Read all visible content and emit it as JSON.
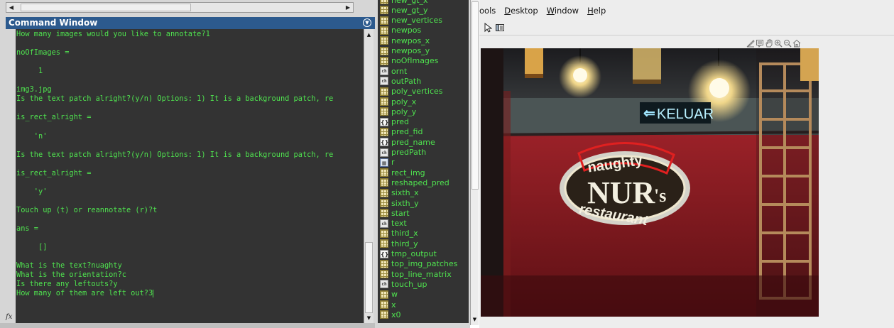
{
  "command_window": {
    "title": "Command Window",
    "lines": [
      "How many images would you like to annotate?1",
      "",
      "noOfImages =",
      "",
      "     1",
      "",
      "img3.jpg",
      "Is the text patch alright?(y/n) Options: 1) It is a background patch, re",
      "",
      "is_rect_alright =",
      "",
      "    'n'",
      "",
      "Is the text patch alright?(y/n) Options: 1) It is a background patch, re",
      "",
      "is_rect_alright =",
      "",
      "    'y'",
      "",
      "Touch up (t) or reannotate (r)?t",
      "",
      "ans =",
      "",
      "     []",
      "",
      "What is the text?nuaghty",
      "What is the orientation?c",
      "Is there any leftouts?y",
      "How many of them are left out?3"
    ],
    "prompt_symbol": "fx"
  },
  "workspace": {
    "items": [
      {
        "name": "new_gt_x",
        "type": "grid"
      },
      {
        "name": "new_gt_y",
        "type": "grid"
      },
      {
        "name": "new_vertices",
        "type": "grid"
      },
      {
        "name": "newpos",
        "type": "grid"
      },
      {
        "name": "newpos_x",
        "type": "grid"
      },
      {
        "name": "newpos_y",
        "type": "grid"
      },
      {
        "name": "noOfImages",
        "type": "grid"
      },
      {
        "name": "ornt",
        "type": "ch"
      },
      {
        "name": "outPath",
        "type": "ch"
      },
      {
        "name": "poly_vertices",
        "type": "grid"
      },
      {
        "name": "poly_x",
        "type": "grid"
      },
      {
        "name": "poly_y",
        "type": "grid"
      },
      {
        "name": "pred",
        "type": "cell"
      },
      {
        "name": "pred_fid",
        "type": "grid"
      },
      {
        "name": "pred_name",
        "type": "cell"
      },
      {
        "name": "predPath",
        "type": "ch"
      },
      {
        "name": "r",
        "type": "struct"
      },
      {
        "name": "rect_img",
        "type": "grid"
      },
      {
        "name": "reshaped_pred",
        "type": "grid"
      },
      {
        "name": "sixth_x",
        "type": "grid"
      },
      {
        "name": "sixth_y",
        "type": "grid"
      },
      {
        "name": "start",
        "type": "grid"
      },
      {
        "name": "text",
        "type": "ch"
      },
      {
        "name": "third_x",
        "type": "grid"
      },
      {
        "name": "third_y",
        "type": "grid"
      },
      {
        "name": "tmp_output",
        "type": "cell"
      },
      {
        "name": "top_img_patches",
        "type": "grid"
      },
      {
        "name": "top_line_matrix",
        "type": "grid"
      },
      {
        "name": "touch_up",
        "type": "ch"
      },
      {
        "name": "w",
        "type": "grid"
      },
      {
        "name": "x",
        "type": "grid"
      },
      {
        "name": "x0",
        "type": "grid"
      }
    ]
  },
  "figure": {
    "menu": [
      {
        "label": "ools",
        "underline_index": -1
      },
      {
        "label": "Desktop",
        "underline_index": 0
      },
      {
        "label": "Window",
        "underline_index": 0
      },
      {
        "label": "Help",
        "underline_index": 0
      }
    ],
    "toolbar_icons": [
      "pointer-icon",
      "dock-panel-icon"
    ],
    "axes_icons": [
      "brush-icon",
      "datatip-icon",
      "pan-hand-icon",
      "zoom-in-icon",
      "zoom-out-icon",
      "home-icon"
    ],
    "image_text": {
      "exit_sign": "KELUAR",
      "annotated_word": "naughty",
      "logo_main": "NUR",
      "logo_suffix": "'s",
      "logo_sub": "restaurant"
    },
    "colors": {
      "annotation_box": "#e02020",
      "exit_sign_glow": "#9fe6ff",
      "wall": "#8f1e24"
    }
  }
}
